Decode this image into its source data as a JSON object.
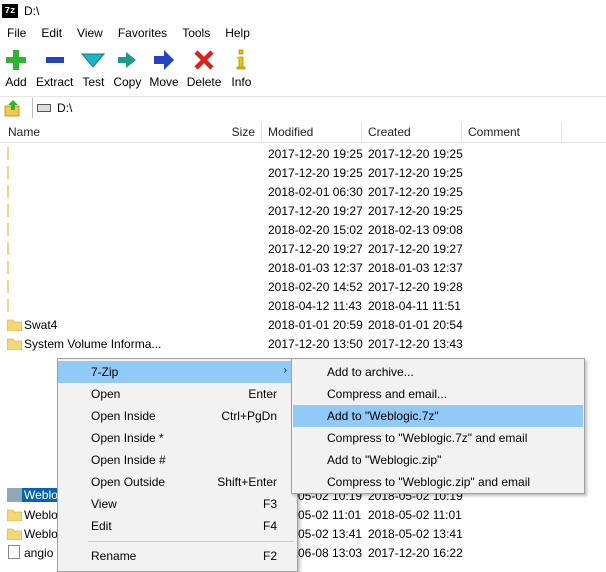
{
  "window": {
    "title": "D:\\",
    "app_icon_text": "7z"
  },
  "menubar": {
    "items": [
      "File",
      "Edit",
      "View",
      "Favorites",
      "Tools",
      "Help"
    ]
  },
  "toolbar": {
    "buttons": [
      {
        "label": "Add",
        "icon": "plus-icon",
        "color": "#2db52d"
      },
      {
        "label": "Extract",
        "icon": "minus-icon",
        "color": "#2144c4"
      },
      {
        "label": "Test",
        "icon": "check-icon",
        "color": "#1ab5c9"
      },
      {
        "label": "Copy",
        "icon": "double-arrow-icon",
        "color": "#1a9c8a"
      },
      {
        "label": "Move",
        "icon": "arrow-right-icon",
        "color": "#2144c4"
      },
      {
        "label": "Delete",
        "icon": "x-icon",
        "color": "#e02020"
      },
      {
        "label": "Info",
        "icon": "info-icon",
        "color": "#e8c800"
      }
    ]
  },
  "address": {
    "path": "D:\\"
  },
  "columns": {
    "name": "Name",
    "size": "Size",
    "modified": "Modified",
    "created": "Created",
    "comment": "Comment"
  },
  "files": [
    {
      "name": "",
      "modified": "2017-12-20 19:25",
      "created": "2017-12-20 19:25"
    },
    {
      "name": "",
      "modified": "2017-12-20 19:25",
      "created": "2017-12-20 19:25"
    },
    {
      "name": "",
      "modified": "2018-02-01 06:30",
      "created": "2017-12-20 19:25"
    },
    {
      "name": "",
      "modified": "2017-12-20 19:27",
      "created": "2017-12-20 19:25"
    },
    {
      "name": "",
      "modified": "2018-02-20 15:02",
      "created": "2018-02-13 09:08"
    },
    {
      "name": "",
      "modified": "2017-12-20 19:27",
      "created": "2017-12-20 19:27"
    },
    {
      "name": "",
      "modified": "2018-01-03 12:37",
      "created": "2018-01-03 12:37"
    },
    {
      "name": "",
      "modified": "2018-02-20 14:52",
      "created": "2017-12-20 19:28"
    },
    {
      "name": "",
      "modified": "2018-04-12 11:43",
      "created": "2018-04-11 11:51"
    },
    {
      "name": "Swat4",
      "modified": "2018-01-01 20:59",
      "created": "2018-01-01 20:54"
    },
    {
      "name": "System Volume Informa...",
      "modified": "2017-12-20 13:50",
      "created": "2017-12-20 13:43"
    }
  ],
  "files_below": [
    {
      "name": "Weblo",
      "modified": "05-02 10:19",
      "created": "2018-05-02 10:19",
      "selected": true
    },
    {
      "name": "Weblo",
      "modified": "05-02 11:01",
      "created": "2018-05-02 11:01"
    },
    {
      "name": "Weblo",
      "modified": "05-02 13:41",
      "created": "2018-05-02 13:41"
    },
    {
      "name": "angio",
      "modified": "06-08 13:03",
      "created": "2017-12-20 16:22"
    }
  ],
  "context_menu": {
    "items": [
      {
        "label": "7-Zip",
        "shortcut": "",
        "submenu": true,
        "highlighted": true
      },
      {
        "label": "Open",
        "shortcut": "Enter"
      },
      {
        "label": "Open Inside",
        "shortcut": "Ctrl+PgDn"
      },
      {
        "label": "Open Inside *",
        "shortcut": ""
      },
      {
        "label": "Open Inside #",
        "shortcut": ""
      },
      {
        "label": "Open Outside",
        "shortcut": "Shift+Enter"
      },
      {
        "label": "View",
        "shortcut": "F3"
      },
      {
        "label": "Edit",
        "shortcut": "F4"
      },
      {
        "label": "Rename",
        "shortcut": "F2"
      }
    ],
    "submenu_arrow": "›"
  },
  "submenu": {
    "items": [
      {
        "label": "Add to archive..."
      },
      {
        "label": "Compress and email..."
      },
      {
        "label": "Add to \"Weblogic.7z\"",
        "highlighted": true
      },
      {
        "label": "Compress to \"Weblogic.7z\" and email"
      },
      {
        "label": "Add to \"Weblogic.zip\""
      },
      {
        "label": "Compress to \"Weblogic.zip\" and email"
      }
    ]
  },
  "colors": {
    "highlight": "#91c9f7",
    "folder": "#f7d774",
    "selection": "#cce8ff"
  }
}
